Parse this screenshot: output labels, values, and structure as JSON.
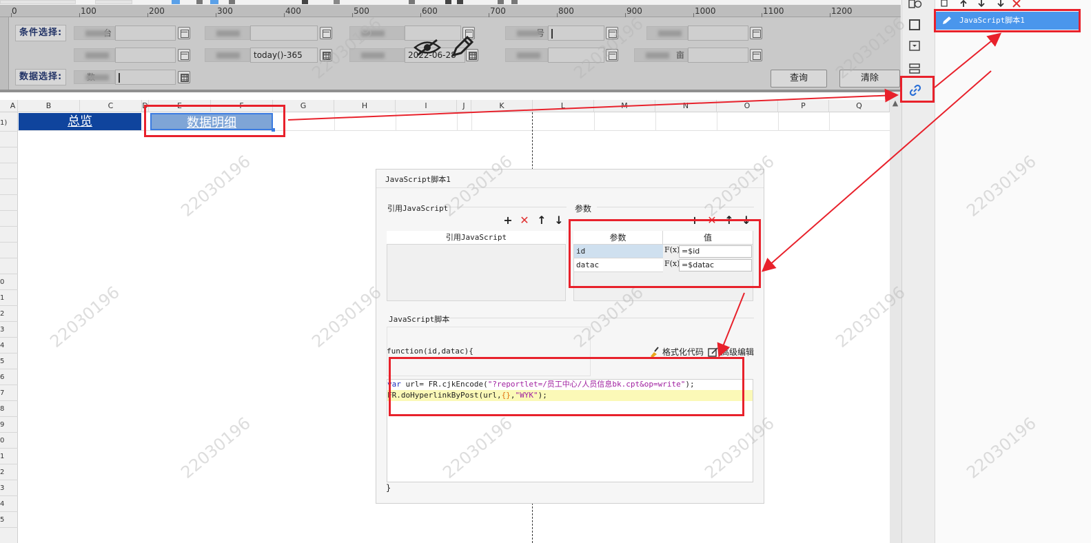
{
  "ruler": {
    "ticks": [
      "0",
      "100",
      "200",
      "300",
      "400",
      "500",
      "600",
      "700",
      "800",
      "900",
      "1000",
      "1100",
      "1200"
    ]
  },
  "param_pane": {
    "condition_label": "条件选择:",
    "data_label": "数据选择:",
    "label_1": "台",
    "label_4": "号",
    "label_8": "亩",
    "label_9": "数",
    "field_today": "today()-365",
    "field_date": "2022-06-28",
    "query_button": "查询",
    "clear_button": "清除"
  },
  "sheet": {
    "columns": [
      "A",
      "B",
      "C",
      "D",
      "E",
      "F",
      "G",
      "H",
      "I",
      "J",
      "K",
      "L",
      "M",
      "N",
      "O",
      "P",
      "Q"
    ],
    "row_labels": [
      "0",
      "1",
      "2",
      "3",
      "4",
      "5",
      "6",
      "7",
      "8",
      "9",
      "0",
      "1",
      "2",
      "3",
      "4",
      "5"
    ],
    "row1_label": "1)",
    "cell_overview": "总览",
    "cell_detail": "数据明细"
  },
  "right_panel": {
    "js_item": "JavaScript脚本1"
  },
  "dialog": {
    "title": "JavaScript脚本1",
    "ref_section": "引用JavaScript",
    "ref_header": "引用JavaScript",
    "param_section": "参数",
    "param_header_name": "参数",
    "param_header_value": "值",
    "params": [
      {
        "name": "id",
        "value": "=$id"
      },
      {
        "name": "datac",
        "value": "=$datac"
      }
    ],
    "fx_label": "F(x)",
    "script_section": "JavaScript脚本",
    "function_signature": "function(id,datac){",
    "format_button": "格式化代码",
    "advanced_button": "高级编辑",
    "code_line1": {
      "a": "var",
      "b": " url= FR.cjkEncode(",
      "c": "\"?reportlet=/员工中心/人员信息bk.cpt&op=write\"",
      "d": ");"
    },
    "code_line2": {
      "a": "FR.doHyperlinkByPost(url,",
      "b": "{}",
      "c": ",",
      "d": "\"WYK\"",
      "e": ");"
    },
    "closing_brace": "}"
  },
  "watermark": "22030196",
  "colors": {
    "annotation_red": "#e8212b",
    "selection_blue": "#4a96ec",
    "overview_blue": "#0f449d"
  }
}
